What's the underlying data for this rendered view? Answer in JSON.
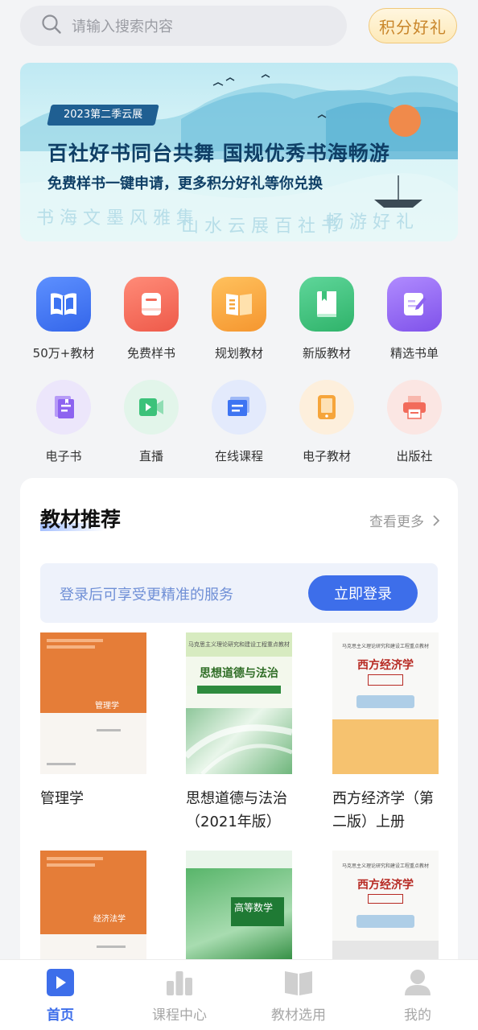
{
  "search": {
    "placeholder": "请输入搜索内容"
  },
  "points_button": "积分好礼",
  "banner": {
    "tag": "2023第二季云展",
    "headline": "百社好书同台共舞  国规优秀书海畅游",
    "subline": "免费样书一键申请，更多积分好礼等你兑换"
  },
  "grid": [
    {
      "label": "50万+教材",
      "icon": "open-book-icon",
      "color": "#3d74f2"
    },
    {
      "label": "免费样书",
      "icon": "gift-book-icon",
      "color": "#f26b5b"
    },
    {
      "label": "规划教材",
      "icon": "planning-book-icon",
      "color": "#f6a53b"
    },
    {
      "label": "新版教材",
      "icon": "new-book-icon",
      "color": "#3cc27a"
    },
    {
      "label": "精选书单",
      "icon": "booklist-edit-icon",
      "color": "#8d63f0"
    },
    {
      "label": "电子书",
      "icon": "ebook-icon",
      "color": "#8d63f0"
    },
    {
      "label": "直播",
      "icon": "live-video-icon",
      "color": "#3cc27a"
    },
    {
      "label": "在线课程",
      "icon": "online-course-icon",
      "color": "#3d74f2"
    },
    {
      "label": "电子教材",
      "icon": "tablet-icon",
      "color": "#f6a53b"
    },
    {
      "label": "出版社",
      "icon": "printer-icon",
      "color": "#f26b5b"
    }
  ],
  "recommend": {
    "title": "教材推荐",
    "more": "查看更多",
    "login_prompt": "登录后可享受更精准的服务",
    "login_button": "立即登录",
    "books": [
      {
        "title": "管理学",
        "cover_text": "管理学"
      },
      {
        "title": "思想道德与法治（2021年版）",
        "cover_text": "思想道德与法治"
      },
      {
        "title": "西方经济学（第二版）上册",
        "cover_text": "西方经济学"
      },
      {
        "title": "",
        "cover_text": "经济法学"
      },
      {
        "title": "",
        "cover_text": "高等数学"
      },
      {
        "title": "",
        "cover_text": "西方经济学"
      }
    ]
  },
  "nav": [
    {
      "label": "首页",
      "active": true
    },
    {
      "label": "课程中心",
      "active": false
    },
    {
      "label": "教材选用",
      "active": false
    },
    {
      "label": "我的",
      "active": false
    }
  ]
}
